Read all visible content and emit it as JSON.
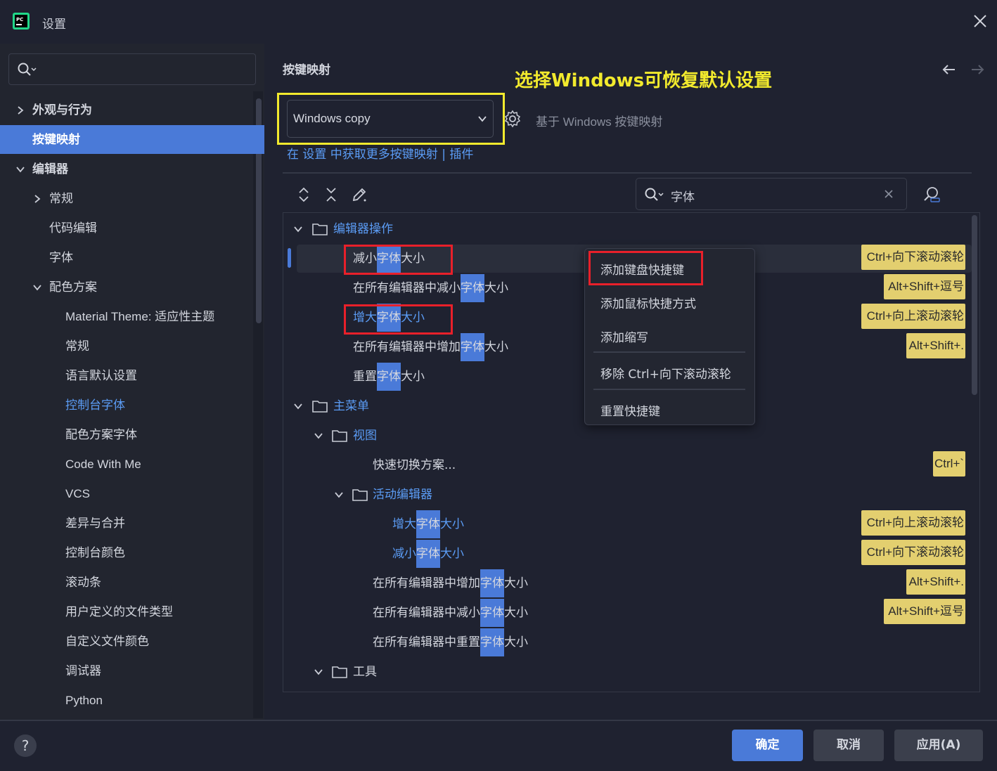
{
  "window": {
    "title": "设置"
  },
  "sidebar": {
    "search_placeholder": "",
    "items": [
      {
        "label": "外观与行为"
      },
      {
        "label": "按键映射"
      },
      {
        "label": "编辑器"
      },
      {
        "label": "常规"
      },
      {
        "label": "代码编辑"
      },
      {
        "label": "字体"
      },
      {
        "label": "配色方案"
      },
      {
        "label": "Material Theme: 适应性主题"
      },
      {
        "label": "常规"
      },
      {
        "label": "语言默认设置"
      },
      {
        "label": "控制台字体"
      },
      {
        "label": "配色方案字体"
      },
      {
        "label": "Code With Me"
      },
      {
        "label": "VCS"
      },
      {
        "label": "差异与合并"
      },
      {
        "label": "控制台颜色"
      },
      {
        "label": "滚动条"
      },
      {
        "label": "用户定义的文件类型"
      },
      {
        "label": "自定义文件颜色"
      },
      {
        "label": "调试器"
      },
      {
        "label": "Python"
      }
    ]
  },
  "main": {
    "title": "按键映射",
    "annotation": "选择Windows可恢复默认设置",
    "keymap": {
      "selected": "Windows copy",
      "based_on": "基于 Windows 按键映射",
      "link": "在 设置 中获取更多按键映射 | 插件"
    },
    "action_search": {
      "value": "字体"
    },
    "tree": {
      "editor_actions": "编辑器操作",
      "main_menu": "主菜单",
      "view": "视图",
      "quick_switch": "快速切换方案...",
      "active_editor": "活动编辑器",
      "tools": "工具",
      "rows": [
        {
          "pre": "减小",
          "hl": "字体",
          "post": "大小",
          "shortcut": "Ctrl+向下滚动滚轮"
        },
        {
          "pre": "在所有编辑器中减小",
          "hl": "字体",
          "post": "大小",
          "shortcut": "Alt+Shift+逗号"
        },
        {
          "pre": "增大",
          "hl": "字体",
          "post": "大小",
          "shortcut": "Ctrl+向上滚动滚轮"
        },
        {
          "pre": "在所有编辑器中增加",
          "hl": "字体",
          "post": "大小",
          "shortcut": "Alt+Shift+."
        },
        {
          "pre": "重置",
          "hl": "字体",
          "post": "大小",
          "shortcut": ""
        },
        {
          "pre": "增大",
          "hl": "字体",
          "post": "大小",
          "shortcut": "Ctrl+向上滚动滚轮"
        },
        {
          "pre": "减小",
          "hl": "字体",
          "post": "大小",
          "shortcut": "Ctrl+向下滚动滚轮"
        },
        {
          "pre": "在所有编辑器中增加",
          "hl": "字体",
          "post": "大小",
          "shortcut": "Alt+Shift+."
        },
        {
          "pre": "在所有编辑器中减小",
          "hl": "字体",
          "post": "大小",
          "shortcut": "Alt+Shift+逗号"
        },
        {
          "pre": "在所有编辑器中重置",
          "hl": "字体",
          "post": "大小",
          "shortcut": ""
        }
      ],
      "quick_switch_shortcut": "Ctrl+`"
    }
  },
  "context_menu": {
    "items": [
      "添加键盘快捷键",
      "添加鼠标快捷方式",
      "添加缩写",
      "移除 Ctrl+向下滚动滚轮",
      "重置快捷键"
    ]
  },
  "footer": {
    "help": "?",
    "ok": "确定",
    "cancel": "取消",
    "apply": "应用(A)"
  },
  "colors": {
    "accent": "#4a7ad8",
    "link": "#5b9cf5",
    "annotation": "#f2ea2d",
    "redbox": "#e8202a",
    "shortcut_bg": "#e3cf6f"
  }
}
